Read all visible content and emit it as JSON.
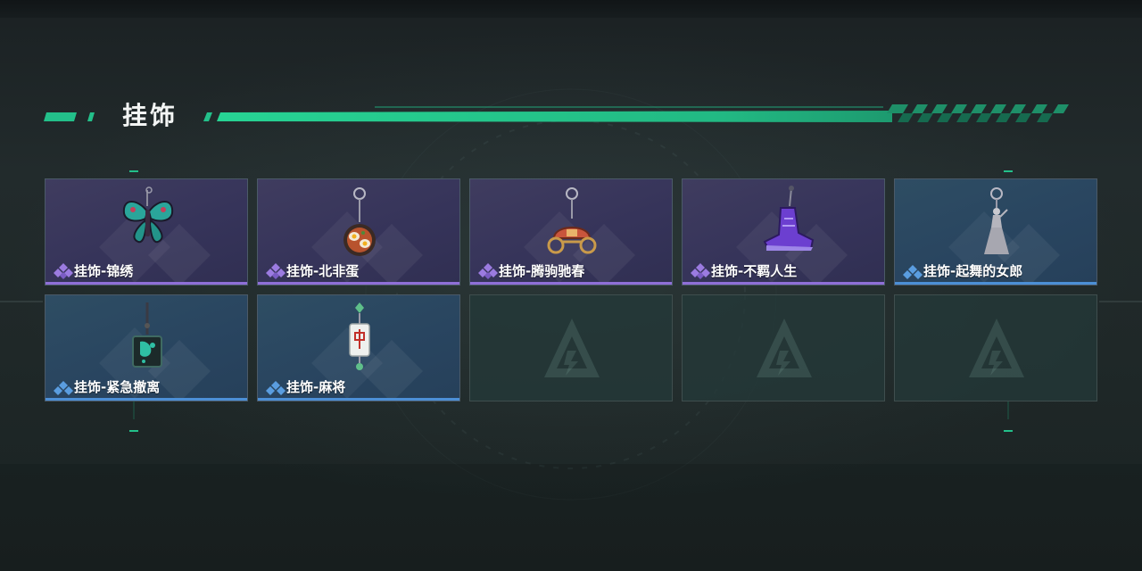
{
  "section": {
    "title": "挂饰"
  },
  "items": [
    {
      "label": "挂饰-锦绣",
      "rarity": "purple",
      "icon": "butterfly-charm-icon"
    },
    {
      "label": "挂饰-北非蛋",
      "rarity": "purple",
      "icon": "shakshuka-pan-charm-icon"
    },
    {
      "label": "挂饰-腾驹驰春",
      "rarity": "purple",
      "icon": "carriage-charm-icon"
    },
    {
      "label": "挂饰-不羁人生",
      "rarity": "purple",
      "icon": "sneaker-charm-icon"
    },
    {
      "label": "挂饰-起舞的女郎",
      "rarity": "blue",
      "icon": "dancer-figurine-charm-icon"
    },
    {
      "label": "挂饰-紧急撤离",
      "rarity": "blue",
      "icon": "teal-tag-charm-icon"
    },
    {
      "label": "挂饰-麻将",
      "rarity": "blue",
      "icon": "mahjong-tile-charm-icon"
    }
  ],
  "empty_slot_icon": "game-logo-placeholder-icon",
  "colors": {
    "accent_green": "#23c08a",
    "rarity_purple": "#8f6fd8",
    "rarity_blue": "#4c8fd6"
  }
}
